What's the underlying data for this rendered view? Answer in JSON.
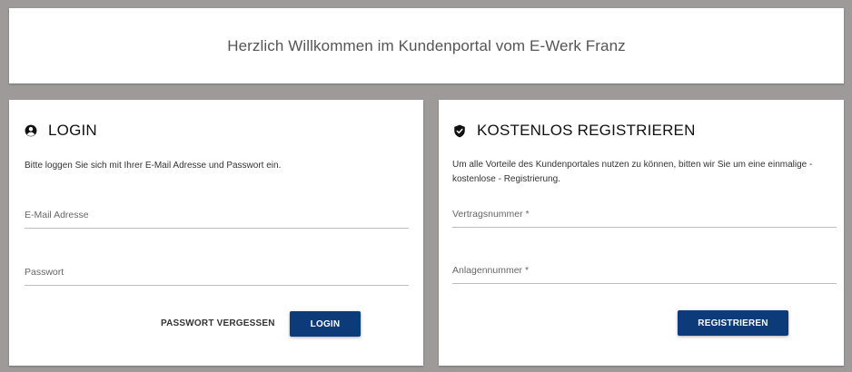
{
  "header": {
    "title": "Herzlich Willkommen im Kundenportal vom E-Werk Franz"
  },
  "login": {
    "icon": "user-circle-icon",
    "title": "LOGIN",
    "description": "Bitte loggen Sie sich mit Ihrer E-Mail Adresse und Passwort ein.",
    "email_placeholder": "E-Mail Adresse",
    "password_placeholder": "Passwort",
    "forgot_label": "PASSWORT VERGESSEN",
    "login_label": "LOGIN"
  },
  "register": {
    "icon": "shield-check-icon",
    "title": "KOSTENLOS REGISTRIEREN",
    "description": "Um alle Vorteile des Kundenportales nutzen zu können, bitten wir Sie um eine einmalige - kostenlose - Registrierung.",
    "contract_placeholder": "Vertragsnummer *",
    "installation_placeholder": "Anlagennummer *",
    "register_label": "REGISTRIEREN"
  },
  "colors": {
    "primary": "#0d3a78",
    "background": "#9e9a9a",
    "card": "#ffffff"
  }
}
